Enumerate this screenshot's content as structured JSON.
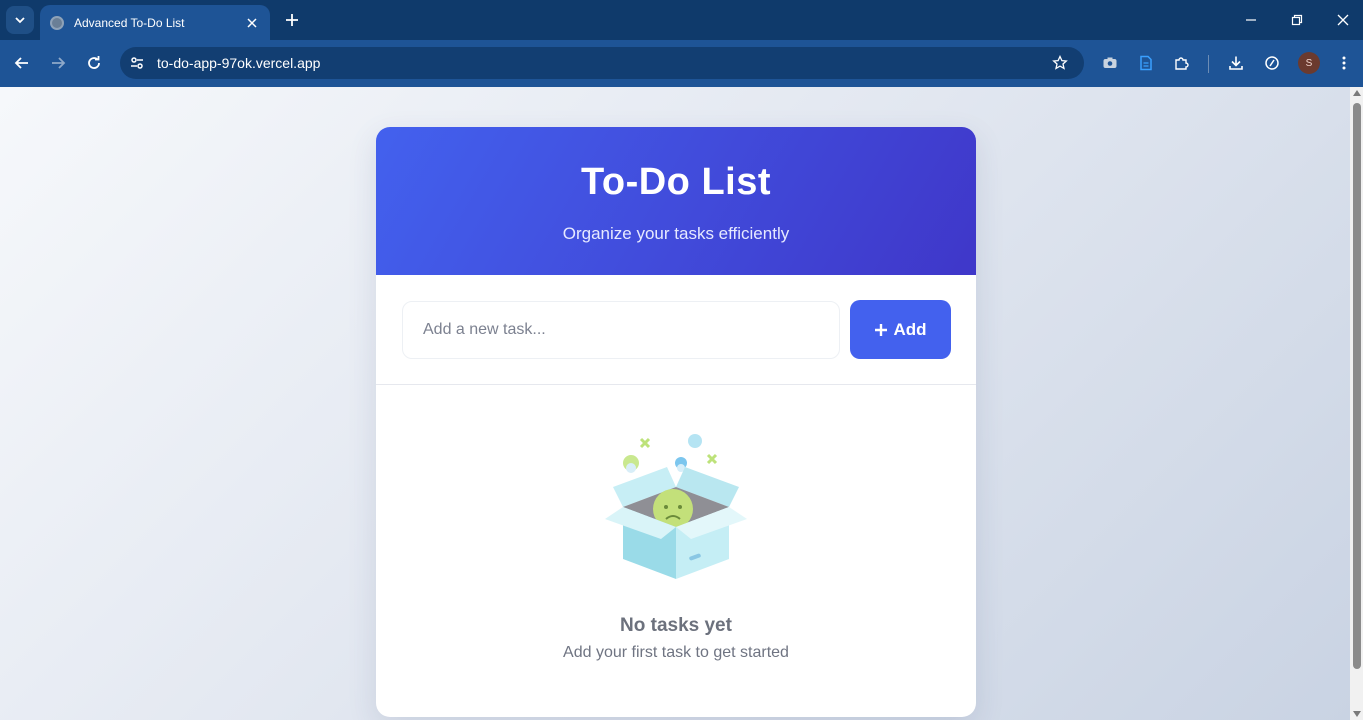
{
  "browser": {
    "tab_title": "Advanced To-Do List",
    "url": "to-do-app-97ok.vercel.app",
    "profile_initial": "S"
  },
  "app": {
    "title": "To-Do List",
    "subtitle": "Organize your tasks efficiently",
    "input_placeholder": "Add a new task...",
    "add_button_label": "Add",
    "empty_title": "No tasks yet",
    "empty_text": "Add your first task to get started"
  },
  "colors": {
    "accent": "#4361ee",
    "header_gradient_end": "#3f37c9",
    "chrome_dark": "#0f3a6b",
    "chrome_toolbar": "#1e5496"
  },
  "icons": {
    "tab_search": "chevron-down-icon",
    "tab_close": "close-icon",
    "new_tab": "plus-icon",
    "back": "arrow-left-icon",
    "forward": "arrow-right-icon",
    "reload": "reload-icon",
    "site_info": "tune-icon",
    "bookmark": "star-icon",
    "add": "plus-icon"
  }
}
